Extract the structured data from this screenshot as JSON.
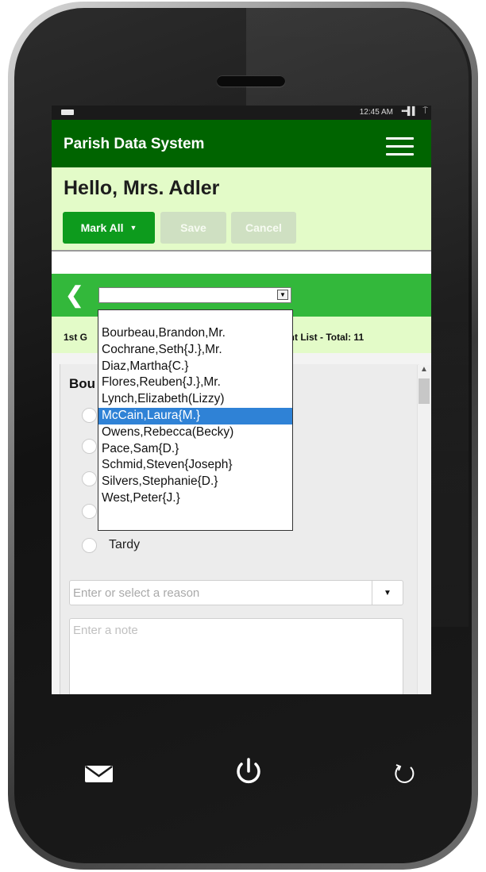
{
  "status_bar": {
    "time": "12:45 AM",
    "signal": "▪▪▪▌▌",
    "wifi": "⍑"
  },
  "header": {
    "title": "Parish Data System"
  },
  "greeting": "Hello, Mrs. Adler",
  "toolbar": {
    "mark_all_label": "Mark All",
    "save_label": "Save",
    "cancel_label": "Cancel"
  },
  "student_select": {
    "selected": ""
  },
  "class_info": {
    "left": "1st G",
    "right": "ent List - Total: 11"
  },
  "card": {
    "heading": "Bou",
    "options": [
      "",
      "",
      "",
      "",
      "Tardy"
    ]
  },
  "reason": {
    "placeholder": "Enter or select a reason"
  },
  "note": {
    "placeholder": "Enter a note"
  },
  "dropdown": {
    "items": [
      "Bourbeau,Brandon,Mr.",
      "Cochrane,Seth{J.},Mr.",
      "Diaz,Martha{C.}",
      "Flores,Reuben{J.},Mr.",
      "Lynch,Elizabeth(Lizzy)",
      "McCain,Laura{M.}",
      "Owens,Rebecca(Becky)",
      "Pace,Sam{D.}",
      "Schmid,Steven{Joseph}",
      "Silvers,Stephanie{D.}",
      "West,Peter{J.}"
    ],
    "selected_index": 5
  },
  "colors": {
    "header_green": "#006400",
    "nav_green": "#33b83b",
    "accent_green": "#0d9b1d",
    "light_green": "#e3fbc8",
    "select_blue": "#2f82d6"
  }
}
